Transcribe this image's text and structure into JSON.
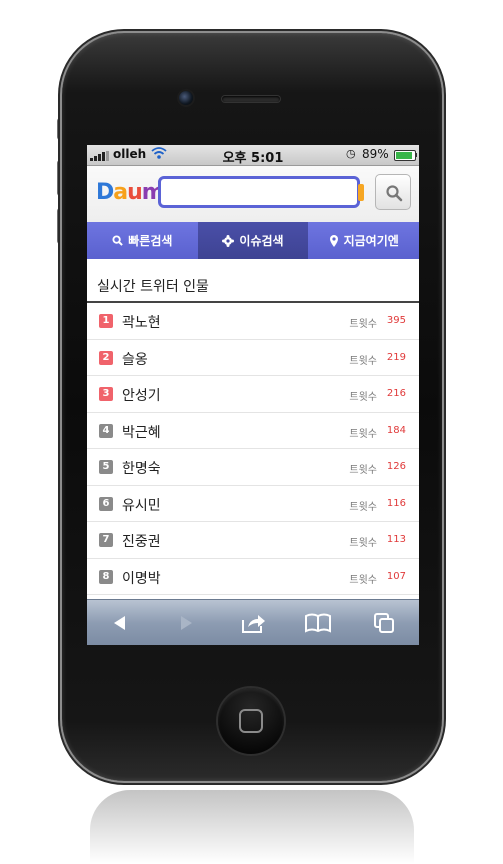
{
  "status_bar": {
    "carrier": "olleh",
    "time_prefix": "오후",
    "time": "5:01",
    "battery": "89%",
    "battery_level": 0.89
  },
  "header": {
    "logo_parts": [
      "D",
      "a",
      "u",
      "m"
    ],
    "search_placeholder": "",
    "search_value": ""
  },
  "tabs": [
    {
      "label": "빠른검색",
      "icon": "search-icon",
      "active": false
    },
    {
      "label": "이슈검색",
      "icon": "gear-icon",
      "active": true
    },
    {
      "label": "지금여기엔",
      "icon": "location-pin-icon",
      "active": false
    }
  ],
  "section": {
    "title": "실시간 트위터 인물"
  },
  "list": {
    "count_label": "트윗수",
    "items": [
      {
        "rank": "1",
        "name": "곽노현",
        "count": "395"
      },
      {
        "rank": "2",
        "name": "슬옹",
        "count": "219"
      },
      {
        "rank": "3",
        "name": "안성기",
        "count": "216"
      },
      {
        "rank": "4",
        "name": "박근혜",
        "count": "184"
      },
      {
        "rank": "5",
        "name": "한명숙",
        "count": "126"
      },
      {
        "rank": "6",
        "name": "유시민",
        "count": "116"
      },
      {
        "rank": "7",
        "name": "진중권",
        "count": "113"
      },
      {
        "rank": "8",
        "name": "이명박",
        "count": "107"
      }
    ]
  },
  "colors": {
    "accent": "#5b63d6",
    "rank_hot": "#f0636b",
    "rank_normal": "#8a8a8a",
    "count_red": "#e03a3a"
  },
  "toolbar": {
    "icons": [
      "back-arrow-icon",
      "forward-arrow-icon",
      "share-icon",
      "bookmarks-icon",
      "pages-icon"
    ]
  }
}
